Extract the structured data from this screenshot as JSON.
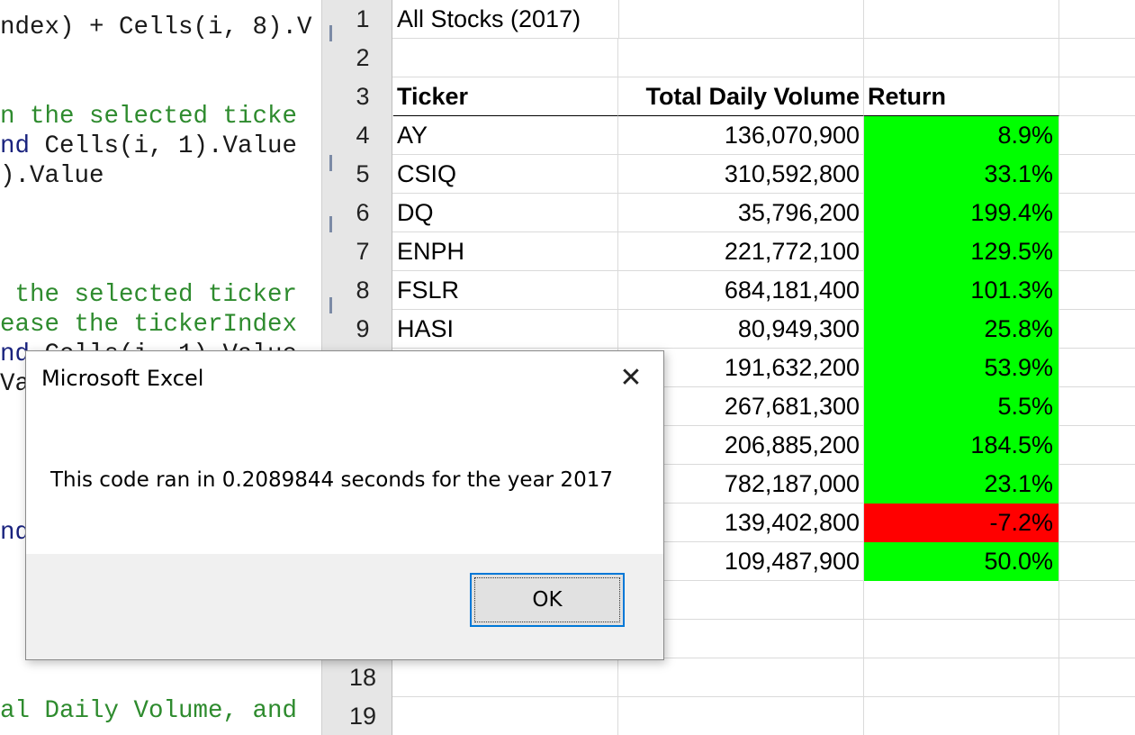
{
  "code_editor": {
    "lines": [
      {
        "text": "ndex) + Cells(i, 8).V",
        "style": "normal"
      },
      {
        "text": "",
        "style": "normal"
      },
      {
        "text": "",
        "style": "normal"
      },
      {
        "text": "n the selected ticke",
        "style": "comment"
      },
      {
        "text": "nd Cells(i, 1).Value",
        "style": "mixed",
        "parts": [
          {
            "t": "nd",
            "s": "keyword"
          },
          {
            "t": " Cells(i, 1).Value",
            "s": "normal"
          }
        ]
      },
      {
        "text": ").Value",
        "style": "normal"
      },
      {
        "text": "",
        "style": "normal"
      },
      {
        "text": "",
        "style": "normal"
      },
      {
        "text": "",
        "style": "normal"
      },
      {
        "text": " the selected ticker",
        "style": "comment"
      },
      {
        "text": "ease the tickerIndex",
        "style": "comment"
      },
      {
        "text": "nd Cells(i, 1).Value",
        "style": "mixed",
        "parts": [
          {
            "t": "nd",
            "s": "keyword"
          },
          {
            "t": " Cells(i, 1).Value",
            "s": "normal"
          }
        ]
      },
      {
        "text": "Va",
        "style": "normal"
      },
      {
        "text": "",
        "style": "normal"
      },
      {
        "text": "",
        "style": "normal"
      },
      {
        "text": "",
        "style": "normal"
      },
      {
        "text": "",
        "style": "normal"
      },
      {
        "text": "nd",
        "style": "keyword"
      },
      {
        "text": "",
        "style": "normal"
      },
      {
        "text": "",
        "style": "normal"
      },
      {
        "text": "",
        "style": "normal"
      },
      {
        "text": "",
        "style": "normal"
      },
      {
        "text": "",
        "style": "normal"
      },
      {
        "text": "al Daily Volume, and",
        "style": "comment"
      }
    ]
  },
  "sheet": {
    "title": "All Stocks (2017)",
    "headers": {
      "ticker": "Ticker",
      "volume": "Total Daily Volume",
      "return": "Return"
    },
    "rows": [
      {
        "num": "4",
        "ticker": "AY",
        "volume": "136,070,900",
        "ret": "8.9%",
        "positive": true
      },
      {
        "num": "5",
        "ticker": "CSIQ",
        "volume": "310,592,800",
        "ret": "33.1%",
        "positive": true
      },
      {
        "num": "6",
        "ticker": "DQ",
        "volume": "35,796,200",
        "ret": "199.4%",
        "positive": true
      },
      {
        "num": "7",
        "ticker": "ENPH",
        "volume": "221,772,100",
        "ret": "129.5%",
        "positive": true
      },
      {
        "num": "8",
        "ticker": "FSLR",
        "volume": "684,181,400",
        "ret": "101.3%",
        "positive": true
      },
      {
        "num": "9",
        "ticker": "HASI",
        "volume": "80,949,300",
        "ret": "25.8%",
        "positive": true
      },
      {
        "num": "",
        "ticker": "",
        "volume": "191,632,200",
        "ret": "53.9%",
        "positive": true
      },
      {
        "num": "",
        "ticker": "",
        "volume": "267,681,300",
        "ret": "5.5%",
        "positive": true
      },
      {
        "num": "",
        "ticker": "",
        "volume": "206,885,200",
        "ret": "184.5%",
        "positive": true
      },
      {
        "num": "",
        "ticker": "",
        "volume": "782,187,000",
        "ret": "23.1%",
        "positive": true
      },
      {
        "num": "",
        "ticker": "",
        "volume": "139,402,800",
        "ret": "-7.2%",
        "positive": false
      },
      {
        "num": "",
        "ticker": "",
        "volume": "109,487,900",
        "ret": "50.0%",
        "positive": true
      }
    ],
    "row_numbers": {
      "r1": "1",
      "r2": "2",
      "r3": "3",
      "r18": "18",
      "r19": "19"
    },
    "colors": {
      "positive": "#00ff00",
      "negative": "#ff0000"
    }
  },
  "dialog": {
    "title": "Microsoft Excel",
    "close_glyph": "✕",
    "message": "This code ran in 0.2089844 seconds for the year 2017",
    "ok_label": "OK"
  }
}
